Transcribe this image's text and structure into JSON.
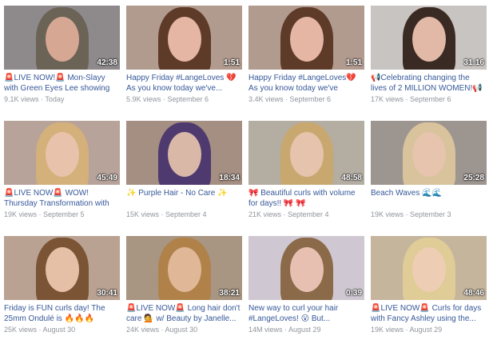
{
  "videos": [
    {
      "title": "🚨LIVE NOW!🚨 Mon-Slayy with Green Eyes Lee showing us...",
      "views": "9.1K views",
      "date": "Today",
      "duration": "42:38",
      "bg": "#8e8a8c",
      "hair": "#6c6357",
      "skin": "#d6a894"
    },
    {
      "title": "Happy Friday #LangeLoves 💔 As you know today we've...",
      "views": "5.9K views",
      "date": "September 6",
      "duration": "1:51",
      "bg": "#b19a8e",
      "hair": "#5e3a28",
      "skin": "#e4b6a3"
    },
    {
      "title": "Happy Friday #LangeLoves💔 As you know today we've reached...",
      "views": "3.4K views",
      "date": "September 6",
      "duration": "1:51",
      "bg": "#b19a8e",
      "hair": "#5e3a28",
      "skin": "#e4b6a3"
    },
    {
      "title": "📢Celebrating changing the lives of 2 MILLION WOMEN!📢",
      "views": "17K views",
      "date": "September 6",
      "duration": "31:16",
      "bg": "#c8c4c2",
      "hair": "#3a2a24",
      "skin": "#e2b8a6"
    },
    {
      "title": "🚨LIVE NOW🚨 WOW! Thursday Transformation with Summer...",
      "views": "19K views",
      "date": "September 5",
      "duration": "45:49",
      "bg": "#b7a39a",
      "hair": "#d4b07a",
      "skin": "#e8c2aa"
    },
    {
      "title": "✨ Purple Hair - No Care ✨",
      "views": "15K views",
      "date": "September 4",
      "duration": "18:34",
      "bg": "#a58f82",
      "hair": "#4e3a6e",
      "skin": "#d9b8a8"
    },
    {
      "title": "🎀 Beautiful curls with volume for days!! 🎀 🎀",
      "views": "21K views",
      "date": "September 4",
      "duration": "48:58",
      "bg": "#b4ada2",
      "hair": "#c9a870",
      "skin": "#e5c3ac"
    },
    {
      "title": "Beach Waves 🌊🌊",
      "views": "19K views",
      "date": "September 3",
      "duration": "25:28",
      "bg": "#9d9590",
      "hair": "#d8c39c",
      "skin": "#e6c4ae"
    },
    {
      "title": "Friday is FUN curls day! The 25mm Ondulé is 🔥🔥🔥",
      "views": "25K views",
      "date": "August 30",
      "duration": "30:41",
      "bg": "#b9a292",
      "hair": "#7a5434",
      "skin": "#e6c0a6"
    },
    {
      "title": "🚨LIVE NOW🚨 Long hair don't care 💁 w/ Beauty by Janelle...",
      "views": "24K views",
      "date": "August 30",
      "duration": "38:21",
      "bg": "#a89582",
      "hair": "#b0824a",
      "skin": "#e0b898"
    },
    {
      "title": "New way to curl your hair #LangeLoves! 😮 But...",
      "views": "14M views",
      "date": "August 29",
      "duration": "0:39",
      "bg": "#cfc8d2",
      "hair": "#8b6a4a",
      "skin": "#e8c0b2"
    },
    {
      "title": "🚨LIVE NOW🚨 Curls for days with Fancy Ashley using the...",
      "views": "19K views",
      "date": "August 29",
      "duration": "48:46",
      "bg": "#c4b59c",
      "hair": "#e0cc96",
      "skin": "#edcdb4"
    }
  ]
}
